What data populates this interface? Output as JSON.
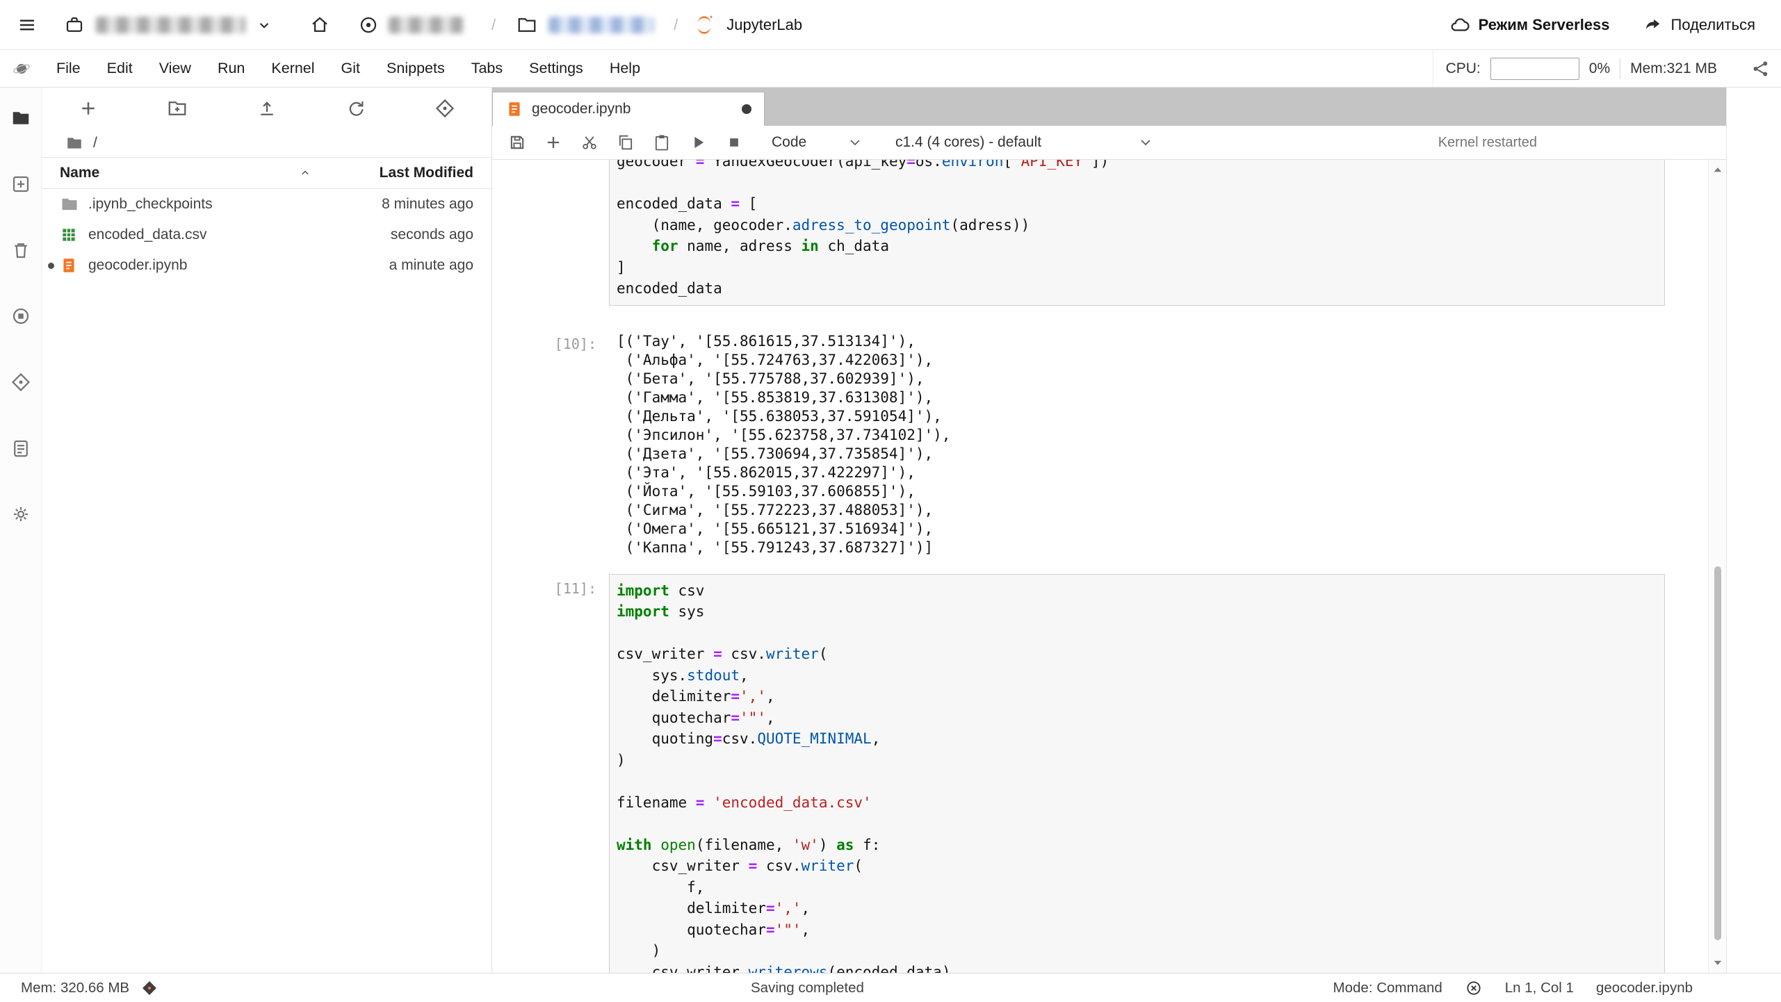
{
  "top_bar": {
    "app": "JupyterLab",
    "separator": "/",
    "serverless_label": "Режим Serverless",
    "share_label": "Поделиться"
  },
  "menu_bar": {
    "items": [
      "File",
      "Edit",
      "View",
      "Run",
      "Kernel",
      "Git",
      "Snippets",
      "Tabs",
      "Settings",
      "Help"
    ],
    "cpu_label": "CPU:",
    "cpu_value": "",
    "cpu_percent": "0%",
    "mem": "Mem:321 MB"
  },
  "activity_bar": {
    "items": [
      "file-browser",
      "new-launcher",
      "trash",
      "running-sessions",
      "git",
      "task-list",
      "settings"
    ]
  },
  "file_browser": {
    "breadcrumb_root": "/",
    "columns": {
      "name": "Name",
      "modified": "Last Modified"
    },
    "rows": [
      {
        "icon": "folder",
        "name": ".ipynb_checkpoints",
        "modified": "8 minutes ago",
        "dirty": false
      },
      {
        "icon": "table",
        "name": "encoded_data.csv",
        "modified": "seconds ago",
        "dirty": false
      },
      {
        "icon": "notebook",
        "name": "geocoder.ipynb",
        "modified": "a minute ago",
        "dirty": true
      }
    ]
  },
  "tab": {
    "title": "geocoder.ipynb"
  },
  "notebook_toolbar": {
    "cell_type": "Code",
    "kernel": "c1.4 (4 cores) - default",
    "status": "Kernel restarted"
  },
  "notebook": {
    "cells": [
      {
        "kind": "code",
        "prompt": "",
        "lines": [
          [
            [
              "t",
              "geocoder "
            ],
            [
              "o",
              "="
            ],
            [
              "t",
              " YandexGeocoder(api_key"
            ],
            [
              "o",
              "="
            ],
            [
              "t",
              "os."
            ],
            [
              "p",
              "environ"
            ],
            [
              "t",
              "["
            ],
            [
              "s",
              "'API_KEY'"
            ],
            [
              "t",
              "])"
            ]
          ],
          [],
          [
            [
              "t",
              "encoded_data "
            ],
            [
              "o",
              "="
            ],
            [
              "t",
              " ["
            ]
          ],
          [
            [
              "t",
              "    (name, geocoder."
            ],
            [
              "p",
              "adress_to_geopoint"
            ],
            [
              "t",
              "(adress))"
            ]
          ],
          [
            [
              "t",
              "    "
            ],
            [
              "k",
              "for"
            ],
            [
              "t",
              " name, adress "
            ],
            [
              "k",
              "in"
            ],
            [
              "t",
              " ch_data"
            ]
          ],
          [
            [
              "t",
              "]"
            ]
          ],
          [
            [
              "t",
              "encoded_data"
            ]
          ]
        ]
      },
      {
        "kind": "output",
        "prompt": "[10]:",
        "lines": [
          "[('Тау', '[55.861615,37.513134]'),",
          " ('Альфа', '[55.724763,37.422063]'),",
          " ('Бета', '[55.775788,37.602939]'),",
          " ('Гамма', '[55.853819,37.631308]'),",
          " ('Дельта', '[55.638053,37.591054]'),",
          " ('Эпсилон', '[55.623758,37.734102]'),",
          " ('Дзета', '[55.730694,37.735854]'),",
          " ('Эта', '[55.862015,37.422297]'),",
          " ('Йота', '[55.59103,37.606855]'),",
          " ('Сигма', '[55.772223,37.488053]'),",
          " ('Омега', '[55.665121,37.516934]'),",
          " ('Каппа', '[55.791243,37.687327]')]"
        ]
      },
      {
        "kind": "code",
        "prompt": "[11]:",
        "lines": [
          [
            [
              "k",
              "import"
            ],
            [
              "t",
              " csv"
            ]
          ],
          [
            [
              "k",
              "import"
            ],
            [
              "t",
              " sys"
            ]
          ],
          [],
          [
            [
              "t",
              "csv_writer "
            ],
            [
              "o",
              "="
            ],
            [
              "t",
              " csv."
            ],
            [
              "p",
              "writer"
            ],
            [
              "t",
              "("
            ]
          ],
          [
            [
              "t",
              "    sys."
            ],
            [
              "p",
              "stdout"
            ],
            [
              "t",
              ","
            ]
          ],
          [
            [
              "t",
              "    delimiter"
            ],
            [
              "o",
              "="
            ],
            [
              "s",
              "','"
            ],
            [
              "t",
              ","
            ]
          ],
          [
            [
              "t",
              "    quotechar"
            ],
            [
              "o",
              "="
            ],
            [
              "s",
              "'\"'"
            ],
            [
              "t",
              ","
            ]
          ],
          [
            [
              "t",
              "    quoting"
            ],
            [
              "o",
              "="
            ],
            [
              "t",
              "csv."
            ],
            [
              "p",
              "QUOTE_MINIMAL"
            ],
            [
              "t",
              ","
            ]
          ],
          [
            [
              "t",
              ")"
            ]
          ],
          [],
          [
            [
              "t",
              "filename "
            ],
            [
              "o",
              "="
            ],
            [
              "t",
              " "
            ],
            [
              "s",
              "'encoded_data.csv'"
            ]
          ],
          [],
          [
            [
              "k",
              "with"
            ],
            [
              "t",
              " "
            ],
            [
              "b",
              "open"
            ],
            [
              "t",
              "(filename, "
            ],
            [
              "s",
              "'w'"
            ],
            [
              "t",
              ") "
            ],
            [
              "k",
              "as"
            ],
            [
              "t",
              " f:"
            ]
          ],
          [
            [
              "t",
              "    csv_writer "
            ],
            [
              "o",
              "="
            ],
            [
              "t",
              " csv."
            ],
            [
              "p",
              "writer"
            ],
            [
              "t",
              "("
            ]
          ],
          [
            [
              "t",
              "        f,"
            ]
          ],
          [
            [
              "t",
              "        delimiter"
            ],
            [
              "o",
              "="
            ],
            [
              "s",
              "','"
            ],
            [
              "t",
              ","
            ]
          ],
          [
            [
              "t",
              "        quotechar"
            ],
            [
              "o",
              "="
            ],
            [
              "s",
              "'\"'"
            ],
            [
              "t",
              ","
            ]
          ],
          [
            [
              "t",
              "    )"
            ]
          ],
          [
            [
              "t",
              "    csv_writer."
            ],
            [
              "p",
              "writerows"
            ],
            [
              "t",
              "(encoded_data)"
            ]
          ]
        ]
      }
    ]
  },
  "status_bar": {
    "mem": "Mem: 320.66 MB",
    "message": "Saving completed",
    "mode": "Mode: Command",
    "cursor": "Ln 1, Col 1",
    "file": "geocoder.ipynb"
  },
  "colors": {
    "jupyter_orange": "#f37626",
    "csv_green": "#388e3c",
    "keyword": "#008000",
    "string": "#ba2121",
    "operator": "#aa22ff",
    "property": "#0055aa"
  }
}
